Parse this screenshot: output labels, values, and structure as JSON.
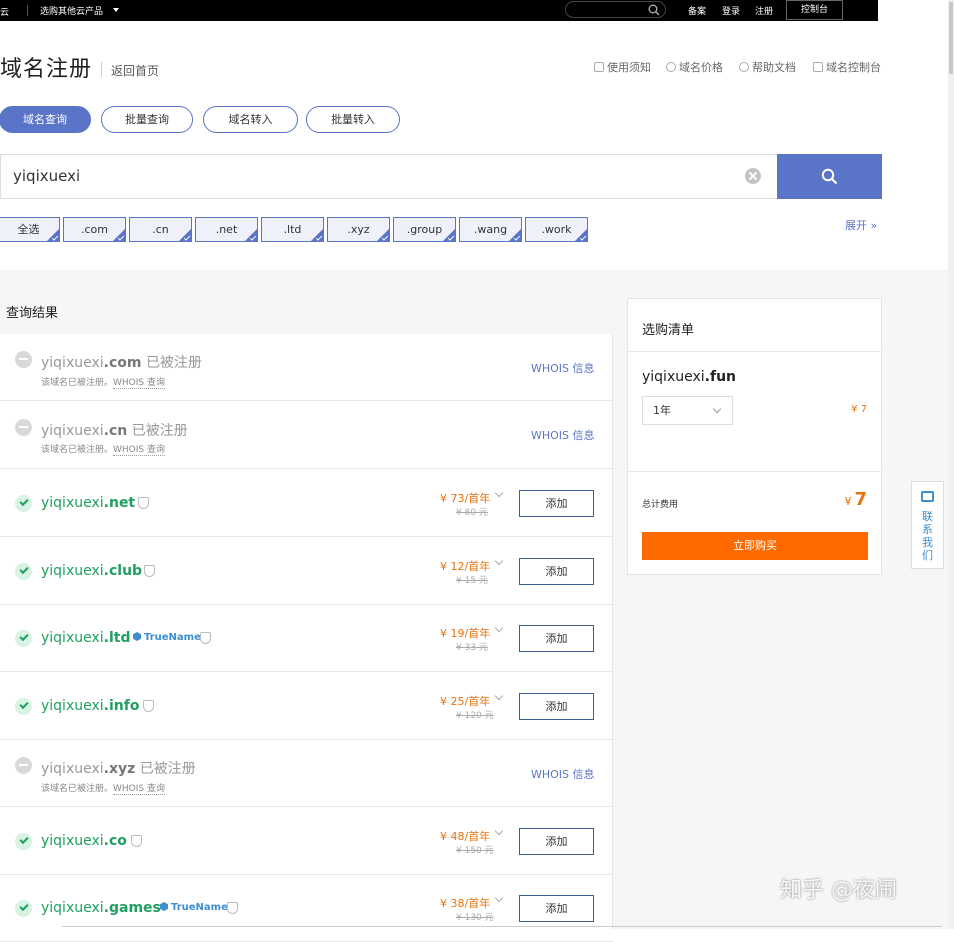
{
  "topbar": {
    "brand": "云",
    "products": "选购其他云产品",
    "links": [
      "备案",
      "登录",
      "注册"
    ],
    "console": "控制台"
  },
  "header": {
    "title": "域名注册",
    "home": "返回首页",
    "links": [
      "使用须知",
      "域名价格",
      "帮助文档",
      "域名控制台"
    ]
  },
  "tabs": [
    "域名查询",
    "批量查询",
    "域名转入",
    "批量转入"
  ],
  "search": {
    "value": "yiqixuexi"
  },
  "tlds": [
    "全选",
    ".com",
    ".cn",
    ".net",
    ".ltd",
    ".xyz",
    ".group",
    ".wang",
    ".work"
  ],
  "expand": "展开",
  "results_title": "查询结果",
  "results": [
    {
      "name": "yiqixuexi",
      "tld": ".com",
      "taken_label": "已被注册",
      "note": "该域名已被注册。",
      "whois_query": "WHOIS 查询",
      "whois": "WHOIS 信息"
    },
    {
      "name": "yiqixuexi",
      "tld": ".cn",
      "taken_label": "已被注册",
      "note": "该域名已被注册。",
      "whois_query": "WHOIS 查询",
      "whois": "WHOIS 信息"
    },
    {
      "name": "yiqixuexi",
      "tld": ".net",
      "price": "¥ 73/首年",
      "old_price": "¥ 80 元",
      "add": "添加"
    },
    {
      "name": "yiqixuexi",
      "tld": ".club",
      "price": "¥ 12/首年",
      "old_price": "¥ 15 元",
      "add": "添加"
    },
    {
      "name": "yiqixuexi",
      "tld": ".ltd",
      "truename": "TrueName",
      "price": "¥ 19/首年",
      "old_price": "¥ 33 元",
      "add": "添加"
    },
    {
      "name": "yiqixuexi",
      "tld": ".info",
      "price": "¥ 25/首年",
      "old_price": "¥ 120 元",
      "add": "添加"
    },
    {
      "name": "yiqixuexi",
      "tld": ".xyz",
      "taken_label": "已被注册",
      "note": "该域名已被注册。",
      "whois_query": "WHOIS 查询",
      "whois": "WHOIS 信息"
    },
    {
      "name": "yiqixuexi",
      "tld": ".co",
      "price": "¥ 48/首年",
      "old_price": "¥ 150 元",
      "add": "添加"
    },
    {
      "name": "yiqixuexi",
      "tld": ".games",
      "truename": "TrueName",
      "price": "¥ 38/首年",
      "old_price": "¥ 130 元",
      "add": "添加"
    }
  ],
  "cart": {
    "title": "选购清单",
    "domain_name": "yiqixuexi",
    "domain_tld": ".fun",
    "period": "1年",
    "price": "¥ 7",
    "total_label": "总计费用",
    "total_currency": "¥",
    "total": "7",
    "buy": "立即购买"
  },
  "contact": "联系我们",
  "watermark": "知乎 @夜闹",
  "colors": {
    "accent": "#5a74c8",
    "available": "#1fa060",
    "price": "#e8730c",
    "buy": "#ff6a00"
  }
}
